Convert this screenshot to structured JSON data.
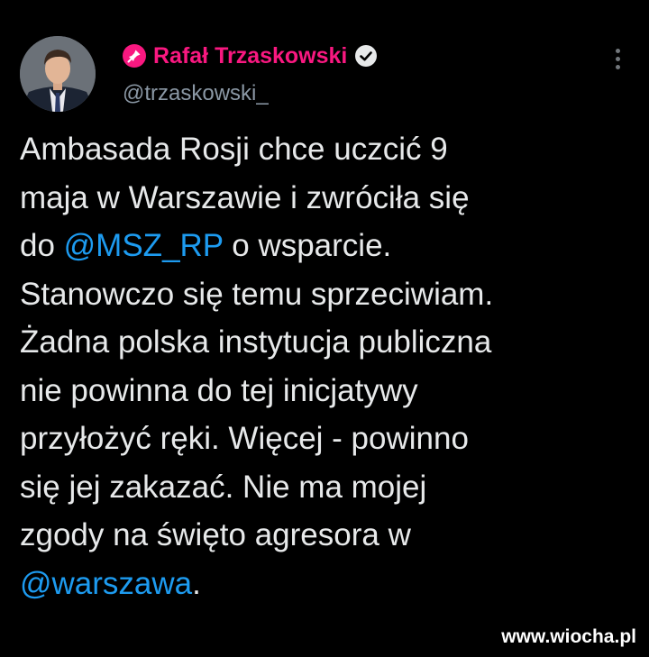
{
  "tweet": {
    "author": {
      "display_name": "Rafał Trzaskowski",
      "handle": "@trzaskowski_",
      "avatar_icon": "avatar-photo",
      "badge_icon": "pin-icon",
      "verified_icon": "verified-badge-icon"
    },
    "more_icon": "more-icon",
    "body": {
      "l1": "Ambasada Rosji chce uczcić 9",
      "l2": "maja w Warszawie i zwróciła się",
      "l3_pre": "do ",
      "l3_mention": "@MSZ_RP",
      "l3_post": " o wsparcie.",
      "l4": "Stanowczo się temu sprzeciwiam.",
      "l5": "Żadna polska instytucja publiczna",
      "l6": "nie powinna do tej inicjatywy",
      "l7": "przyłożyć ręki. Więcej - powinno",
      "l8": "się jej zakazać. Nie ma mojej",
      "l9": "zgody na święto agresora w",
      "l10_mention": "@warszawa",
      "l10_post": "."
    }
  },
  "watermark": "www.wiocha.pl",
  "colors": {
    "background": "#000000",
    "name": "#f91880",
    "mention": "#1d9bf0",
    "text": "#e7e9ea",
    "handle": "#8b98a5"
  }
}
